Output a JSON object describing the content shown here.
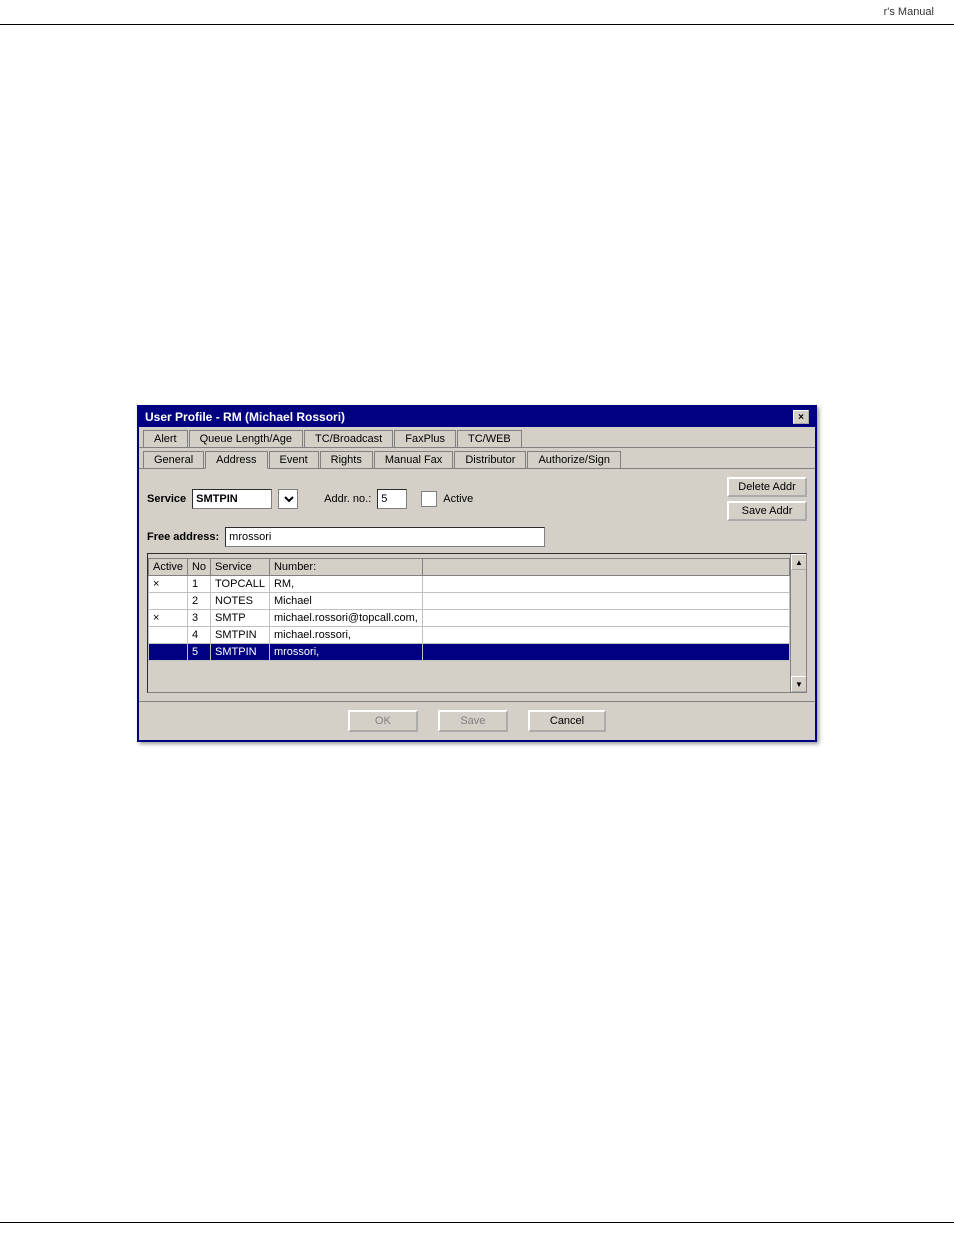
{
  "header": {
    "text": "r's Manual"
  },
  "dialog": {
    "title": "User Profile - RM (Michael Rossori)",
    "close_label": "×",
    "tab_rows": [
      [
        {
          "label": "Alert",
          "active": false
        },
        {
          "label": "Queue Length/Age",
          "active": false
        },
        {
          "label": "TC/Broadcast",
          "active": false
        },
        {
          "label": "FaxPlus",
          "active": false
        },
        {
          "label": "TC/WEB",
          "active": false
        }
      ],
      [
        {
          "label": "General",
          "active": false
        },
        {
          "label": "Address",
          "active": true
        },
        {
          "label": "Event",
          "active": false
        },
        {
          "label": "Rights",
          "active": false
        },
        {
          "label": "Manual Fax",
          "active": false
        },
        {
          "label": "Distributor",
          "active": false
        },
        {
          "label": "Authorize/Sign",
          "active": false
        }
      ]
    ],
    "service_label": "Service",
    "service_value": "SMTPIN",
    "addr_no_label": "Addr. no.:",
    "addr_no_value": "5",
    "active_label": "Active",
    "free_addr_label": "Free address:",
    "free_addr_value": "mrossori",
    "delete_addr_btn": "Delete Addr",
    "save_addr_btn": "Save Addr",
    "table": {
      "columns": [
        "Active",
        "No",
        "Service",
        "Number:"
      ],
      "rows": [
        {
          "active": "×",
          "no": "1",
          "service": "TOPCALL",
          "number": "RM,",
          "selected": false
        },
        {
          "active": "",
          "no": "2",
          "service": "NOTES",
          "number": "Michael",
          "selected": false
        },
        {
          "active": "×",
          "no": "3",
          "service": "SMTP",
          "number": "michael.rossori@topcall.com,",
          "selected": false
        },
        {
          "active": "",
          "no": "4",
          "service": "SMTPIN",
          "number": "michael.rossori,",
          "selected": false
        },
        {
          "active": "",
          "no": "5",
          "service": "SMTPIN",
          "number": "mrossori,",
          "selected": true
        }
      ]
    },
    "footer_buttons": [
      {
        "label": "OK",
        "disabled": true
      },
      {
        "label": "Save",
        "disabled": true
      },
      {
        "label": "Cancel",
        "disabled": false
      }
    ]
  }
}
